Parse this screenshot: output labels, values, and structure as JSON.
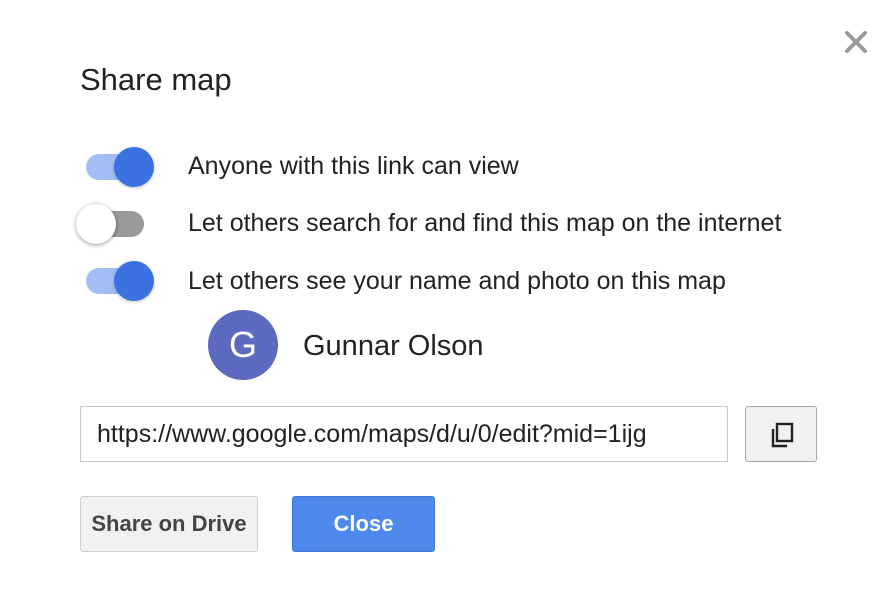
{
  "dialog": {
    "title": "Share map",
    "close_icon": "close-icon"
  },
  "options": [
    {
      "label": "Anyone with this link can view",
      "enabled": true
    },
    {
      "label": "Let others search for and find this map on the internet",
      "enabled": false
    },
    {
      "label": "Let others see your name and photo on this map",
      "enabled": true
    }
  ],
  "user": {
    "initial": "G",
    "name": "Gunnar Olson",
    "avatar_color": "#5c6bc0"
  },
  "link": {
    "value": "https://www.google.com/maps/d/u/0/edit?mid=1ijg",
    "copy_icon": "copy-icon"
  },
  "buttons": {
    "share_drive": "Share on Drive",
    "close": "Close"
  },
  "colors": {
    "accent": "#3b71e0",
    "accent_light": "#a3bdf5",
    "primary_button": "#4d88ea"
  }
}
